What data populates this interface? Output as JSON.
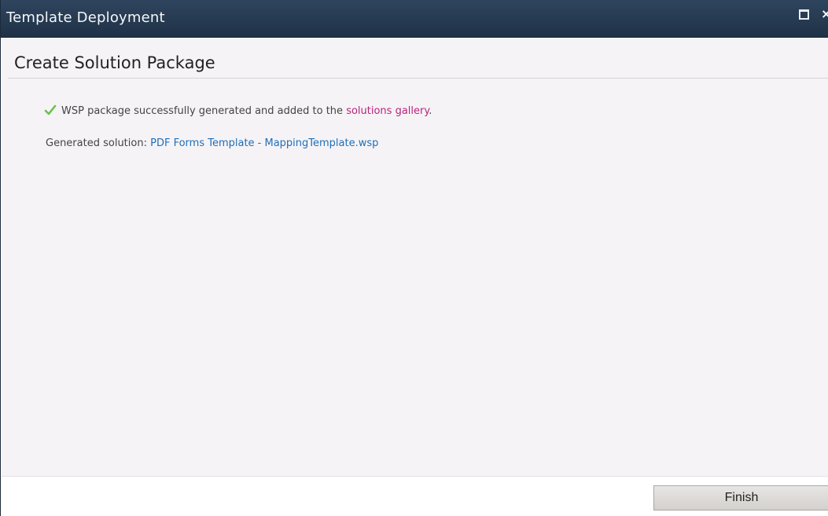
{
  "window": {
    "title": "Template Deployment",
    "maximize_icon": "maximize-icon",
    "close_icon": "close-icon",
    "close_glyph": "×"
  },
  "main": {
    "heading": "Create Solution Package",
    "status": {
      "icon": "checkmark-icon",
      "icon_color": "#6cc04a",
      "text_before": "WSP package successfully generated and added to the",
      "link_text": "solutions gallery",
      "text_after": "."
    },
    "generated": {
      "label": "Generated solution:",
      "link_text": "PDF Forms Template - MappingTemplate.wsp"
    }
  },
  "footer": {
    "finish_label": "Finish"
  },
  "colors": {
    "titlebar": "#26394f",
    "content_bg": "#f6f3f6",
    "link_magenta": "#b8247b",
    "link_blue": "#1e6fb9"
  }
}
